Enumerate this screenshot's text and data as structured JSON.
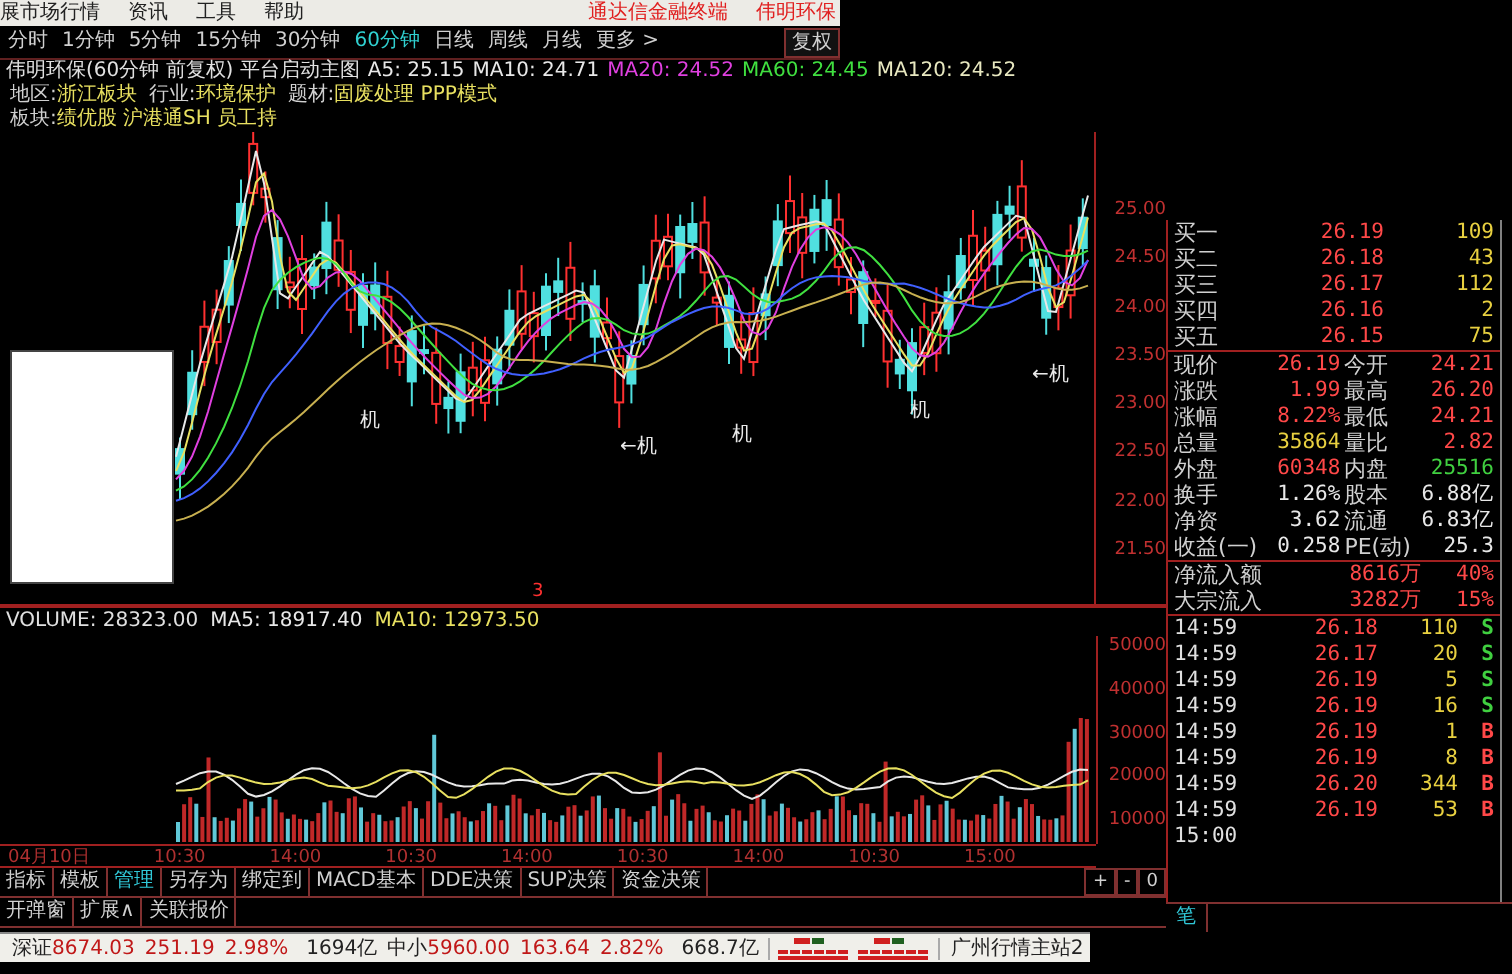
{
  "menu_bar": {
    "items": [
      "展市场行情",
      "资讯",
      "工具",
      "帮助"
    ],
    "brand": "通达信金融终端",
    "stock": "伟明环保"
  },
  "period_tabs": [
    {
      "label": "分时",
      "selected": false
    },
    {
      "label": "1分钟",
      "selected": false
    },
    {
      "label": "5分钟",
      "selected": false
    },
    {
      "label": "15分钟",
      "selected": false
    },
    {
      "label": "30分钟",
      "selected": false
    },
    {
      "label": "60分钟",
      "selected": true
    },
    {
      "label": "日线",
      "selected": false
    },
    {
      "label": "周线",
      "selected": false
    },
    {
      "label": "月线",
      "selected": false
    },
    {
      "label": "更多 >",
      "selected": false
    }
  ],
  "restore_button": "复权",
  "chart_header": {
    "title": "伟明环保(60分钟 前复权) 平台启动主图",
    "indicators": [
      {
        "label": "A5: 25.15",
        "color": "#e8e8e8"
      },
      {
        "label": "MA10: 24.71",
        "color": "#e8e8e8"
      },
      {
        "label": "MA20: 24.52",
        "color": "#e040e0"
      },
      {
        "label": "MA60: 24.45",
        "color": "#40e040"
      },
      {
        "label": "MA120: 24.52",
        "color": "#e8e8c0"
      }
    ]
  },
  "info_lines": [
    [
      {
        "label": "地区:",
        "value": "浙江板块"
      },
      {
        "label": "行业:",
        "value": "环境保护"
      },
      {
        "label": "题材:",
        "value": "固废处理 PPP模式"
      }
    ],
    [
      {
        "label": "板块:",
        "value": "绩优股 沪港通SH 员工持"
      }
    ]
  ],
  "annotations": [
    "机",
    "←机",
    "机",
    "机",
    "←机"
  ],
  "price_axis": [
    "25.00",
    "24.50",
    "24.00",
    "23.50",
    "23.00",
    "22.50",
    "22.00",
    "21.50"
  ],
  "volume_header": {
    "label": "VOLUME: 28323.00",
    "ma": [
      {
        "label": "MA5: 18917.40",
        "color": "#e8e8e8"
      },
      {
        "label": "MA10: 12973.50",
        "color": "#e8e060"
      }
    ]
  },
  "cursor_marker": "3",
  "volume_axis": [
    "50000",
    "40000",
    "30000",
    "20000",
    "10000"
  ],
  "time_axis": [
    "04月10日",
    "10:30",
    "14:00",
    "10:30",
    "14:00",
    "10:30",
    "14:00",
    "10:30",
    "15:00"
  ],
  "zoom_buttons": [
    "+",
    "-",
    "0"
  ],
  "toolbar_tabs": [
    {
      "label": "指标",
      "selected": false
    },
    {
      "label": "模板",
      "selected": false
    },
    {
      "label": "管理",
      "selected": true
    },
    {
      "label": "另存为",
      "selected": false
    },
    {
      "label": "绑定到",
      "selected": false
    },
    {
      "label": "MACD基本",
      "selected": false
    },
    {
      "label": "DDE决策",
      "selected": false
    },
    {
      "label": "SUP决策",
      "selected": false
    },
    {
      "label": "资金决策",
      "selected": false
    }
  ],
  "toolbar_row2": [
    "开弹窗",
    "扩展∧",
    "关联报价"
  ],
  "status_bar": {
    "indices": [
      {
        "name": "深证",
        "value": "8674.03",
        "change": "251.19",
        "percent": "2.98%",
        "amount": "1694亿"
      },
      {
        "name": "中小",
        "value": "5960.00",
        "change": "163.64",
        "percent": "2.82%",
        "amount": "668.7亿"
      }
    ],
    "server": "广州行情主站2"
  },
  "quote_panel": {
    "bids": [
      {
        "label": "买一",
        "price": "26.19",
        "volume": "109"
      },
      {
        "label": "买二",
        "price": "26.18",
        "volume": "43"
      },
      {
        "label": "买三",
        "price": "26.17",
        "volume": "112"
      },
      {
        "label": "买四",
        "price": "26.16",
        "volume": "2"
      },
      {
        "label": "买五",
        "price": "26.15",
        "volume": "75"
      }
    ],
    "stats": [
      {
        "cells": [
          {
            "label": "现价",
            "value": "26.19",
            "color": "#ff4848"
          },
          {
            "label": "今开",
            "value": "24.21",
            "color": "#ff4848"
          }
        ]
      },
      {
        "cells": [
          {
            "label": "涨跌",
            "value": "1.99",
            "color": "#ff4848"
          },
          {
            "label": "最高",
            "value": "26.20",
            "color": "#ff4848"
          }
        ]
      },
      {
        "cells": [
          {
            "label": "涨幅",
            "value": "8.22%",
            "color": "#ff4848"
          },
          {
            "label": "最低",
            "value": "24.21",
            "color": "#ff4848"
          }
        ]
      },
      {
        "cells": [
          {
            "label": "总量",
            "value": "35864",
            "color": "#e8d040"
          },
          {
            "label": "量比",
            "value": "2.82",
            "color": "#ff4848"
          }
        ]
      },
      {
        "cells": [
          {
            "label": "外盘",
            "value": "60348",
            "color": "#ff4848"
          },
          {
            "label": "内盘",
            "value": "25516",
            "color": "#40d040"
          }
        ]
      },
      {
        "cells": [
          {
            "label": "换手",
            "value": "1.26%",
            "color": "#e8e8e8"
          },
          {
            "label": "股本",
            "value": "6.88亿",
            "color": "#e8e8e8"
          }
        ]
      },
      {
        "cells": [
          {
            "label": "净资",
            "value": "3.62",
            "color": "#e8e8e8"
          },
          {
            "label": "流通",
            "value": "6.83亿",
            "color": "#e8e8e8"
          }
        ]
      },
      {
        "cells": [
          {
            "label": "收益(一)",
            "value": "0.258",
            "color": "#e8e8e8"
          },
          {
            "label": "PE(动)",
            "value": "25.3",
            "color": "#e8e8e8"
          }
        ]
      }
    ],
    "flows": [
      {
        "label": "净流入额",
        "amount": "8616万",
        "percent": "40%"
      },
      {
        "label": "大宗流入",
        "amount": "3282万",
        "percent": "15%"
      }
    ],
    "ticks": [
      {
        "time": "14:59",
        "price": "26.18",
        "volume": "110",
        "side": "S",
        "color": "#40d040"
      },
      {
        "time": "14:59",
        "price": "26.17",
        "volume": "20",
        "side": "S",
        "color": "#40d040"
      },
      {
        "time": "14:59",
        "price": "26.19",
        "volume": "5",
        "side": "S",
        "color": "#40d040"
      },
      {
        "time": "14:59",
        "price": "26.19",
        "volume": "16",
        "side": "S",
        "color": "#40d040"
      },
      {
        "time": "14:59",
        "price": "26.19",
        "volume": "1",
        "side": "B",
        "color": "#ff4848"
      },
      {
        "time": "14:59",
        "price": "26.19",
        "volume": "8",
        "side": "B",
        "color": "#ff4848"
      },
      {
        "time": "14:59",
        "price": "26.20",
        "volume": "344",
        "side": "B",
        "color": "#ff4848"
      },
      {
        "time": "14:59",
        "price": "26.19",
        "volume": "53",
        "side": "B",
        "color": "#ff4848"
      },
      {
        "time": "15:00"
      }
    ],
    "tab": "笔"
  }
}
